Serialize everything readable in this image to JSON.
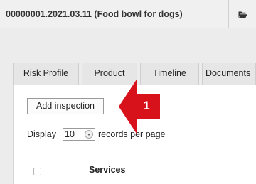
{
  "header": {
    "case_title": "00000001.2021.03.11 (Food bowl for dogs)",
    "folder_icon": "folder-open-icon"
  },
  "tabs": [
    {
      "label": "Risk Profile"
    },
    {
      "label": "Product"
    },
    {
      "label": "Timeline"
    },
    {
      "label": "Documents"
    }
  ],
  "toolbar": {
    "add_inspection_label": "Add inspection"
  },
  "pagination": {
    "display_label": "Display",
    "page_size": "10",
    "records_label": "records per page"
  },
  "table": {
    "columns": [
      "Services"
    ]
  },
  "annotation": {
    "number": "1",
    "color": "#d8121b",
    "icon": "arrow-left-icon"
  }
}
